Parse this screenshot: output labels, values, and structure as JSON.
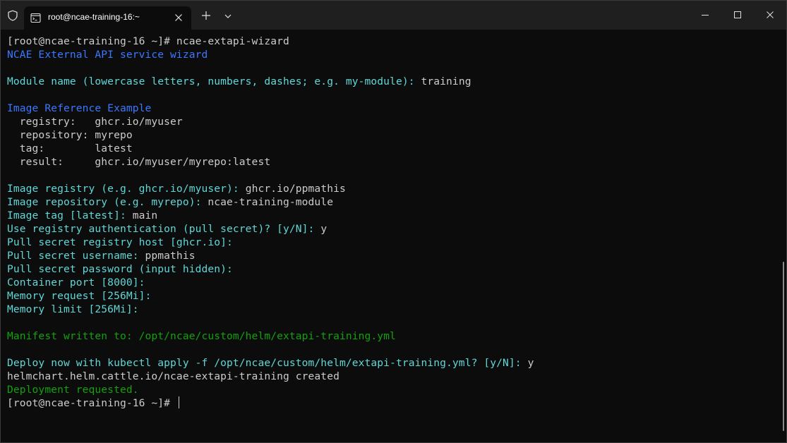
{
  "window": {
    "tab_title": "root@ncae-training-16:~",
    "icons": {
      "shield": "shield-icon",
      "tab": "terminal-tab-icon",
      "close_tab": "close-icon",
      "new_tab": "plus-icon",
      "dropdown": "chevron-down-icon",
      "minimize": "minimize-icon",
      "maximize": "maximize-icon",
      "close": "close-icon"
    }
  },
  "colors": {
    "background": "#0c0c0c",
    "titlebar": "#1f1f1f",
    "default_text": "#cccccc",
    "blue": "#3b78ff",
    "cyan": "#61d6d6",
    "green": "#13a10e"
  },
  "terminal": {
    "lines": [
      {
        "segments": [
          {
            "text": "[root@ncae-training-16 ~]# ncae-extapi-wizard",
            "color": "default"
          }
        ]
      },
      {
        "segments": [
          {
            "text": "NCAE External API service wizard",
            "color": "blue"
          }
        ]
      },
      {
        "segments": []
      },
      {
        "segments": [
          {
            "text": "Module name (lowercase letters, numbers, dashes; e.g. my-module): ",
            "color": "cyan"
          },
          {
            "text": "training",
            "color": "default"
          }
        ]
      },
      {
        "segments": []
      },
      {
        "segments": [
          {
            "text": "Image Reference Example",
            "color": "blue"
          }
        ]
      },
      {
        "segments": [
          {
            "text": "  registry:   ghcr.io/myuser",
            "color": "default"
          }
        ]
      },
      {
        "segments": [
          {
            "text": "  repository: myrepo",
            "color": "default"
          }
        ]
      },
      {
        "segments": [
          {
            "text": "  tag:        latest",
            "color": "default"
          }
        ]
      },
      {
        "segments": [
          {
            "text": "  result:     ghcr.io/myuser/myrepo:latest",
            "color": "default"
          }
        ]
      },
      {
        "segments": []
      },
      {
        "segments": [
          {
            "text": "Image registry (e.g. ghcr.io/myuser): ",
            "color": "cyan"
          },
          {
            "text": "ghcr.io/ppmathis",
            "color": "default"
          }
        ]
      },
      {
        "segments": [
          {
            "text": "Image repository (e.g. myrepo): ",
            "color": "cyan"
          },
          {
            "text": "ncae-training-module",
            "color": "default"
          }
        ]
      },
      {
        "segments": [
          {
            "text": "Image tag [latest]: ",
            "color": "cyan"
          },
          {
            "text": "main",
            "color": "default"
          }
        ]
      },
      {
        "segments": [
          {
            "text": "Use registry authentication (pull secret)? [y/N]: ",
            "color": "cyan"
          },
          {
            "text": "y",
            "color": "default"
          }
        ]
      },
      {
        "segments": [
          {
            "text": "Pull secret registry host [ghcr.io]: ",
            "color": "cyan"
          }
        ]
      },
      {
        "segments": [
          {
            "text": "Pull secret username: ",
            "color": "cyan"
          },
          {
            "text": "ppmathis",
            "color": "default"
          }
        ]
      },
      {
        "segments": [
          {
            "text": "Pull secret password (input hidden): ",
            "color": "cyan"
          }
        ]
      },
      {
        "segments": [
          {
            "text": "Container port [8000]: ",
            "color": "cyan"
          }
        ]
      },
      {
        "segments": [
          {
            "text": "Memory request [256Mi]: ",
            "color": "cyan"
          }
        ]
      },
      {
        "segments": [
          {
            "text": "Memory limit [256Mi]: ",
            "color": "cyan"
          }
        ]
      },
      {
        "segments": []
      },
      {
        "segments": [
          {
            "text": "Manifest written to: /opt/ncae/custom/helm/extapi-training.yml",
            "color": "green"
          }
        ]
      },
      {
        "segments": []
      },
      {
        "segments": [
          {
            "text": "Deploy now with kubectl apply -f /opt/ncae/custom/helm/extapi-training.yml? [y/N]: ",
            "color": "cyan"
          },
          {
            "text": "y",
            "color": "default"
          }
        ]
      },
      {
        "segments": [
          {
            "text": "helmchart.helm.cattle.io/ncae-extapi-training created",
            "color": "default"
          }
        ]
      },
      {
        "segments": [
          {
            "text": "Deployment requested.",
            "color": "green"
          }
        ]
      },
      {
        "segments": [
          {
            "text": "[root@ncae-training-16 ~]# ",
            "color": "default"
          }
        ],
        "cursor": true
      }
    ]
  }
}
